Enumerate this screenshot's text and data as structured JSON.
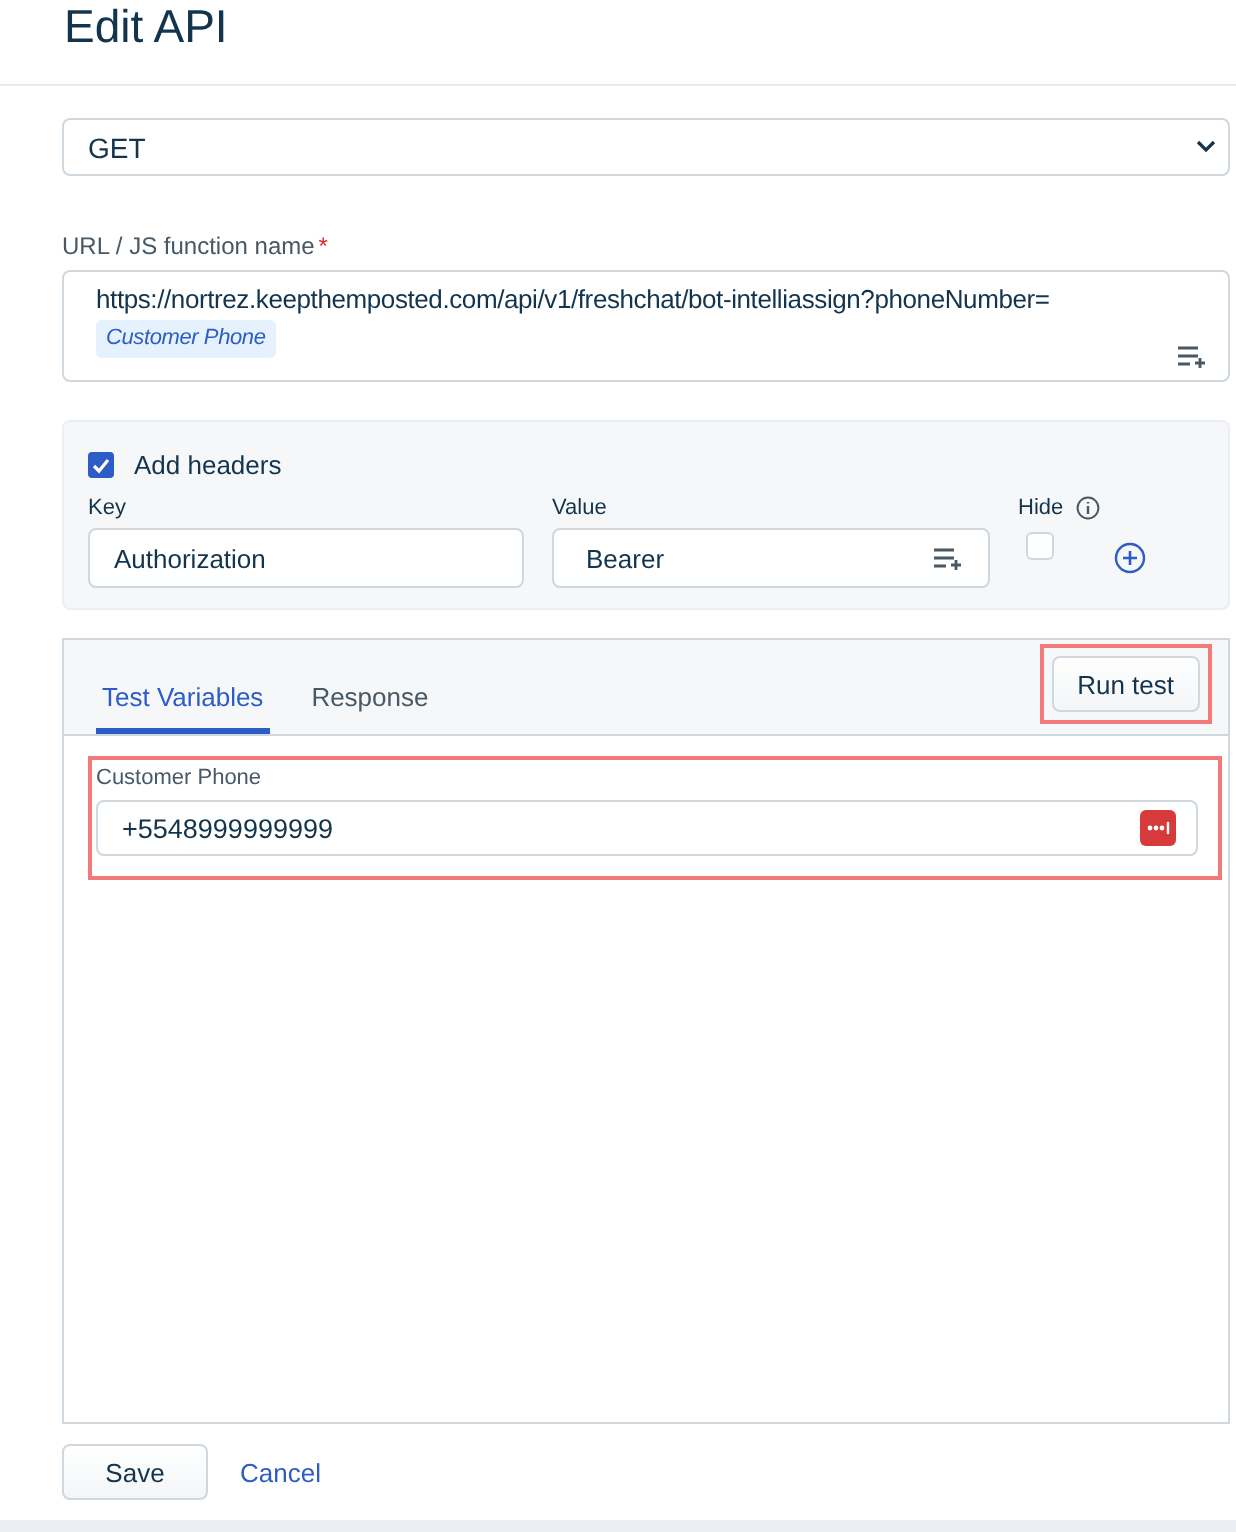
{
  "title": "Edit API",
  "method": {
    "value": "GET"
  },
  "url": {
    "label": "URL / JS function name",
    "required_mark": "*",
    "value": "https://nortrez.keepthemposted.com/api/v1/freshchat/bot-intelliassign?phoneNumber=",
    "tokens": [
      "Customer Phone"
    ]
  },
  "headers": {
    "label": "Add headers",
    "checked": true,
    "columns": [
      "Key",
      "Value",
      "Hide"
    ],
    "rows": [
      {
        "key": "Authorization",
        "value": "Bearer",
        "hidden": false
      }
    ]
  },
  "test": {
    "tabs": [
      {
        "label": "Test Variables",
        "selected": true
      },
      {
        "label": "Response",
        "selected": false
      }
    ],
    "run_button": "Run test",
    "highlighted": true,
    "variables": [
      {
        "label": "Customer Phone",
        "value": "+5548999999999"
      }
    ]
  },
  "actions": {
    "save": "Save",
    "cancel": "Cancel"
  }
}
